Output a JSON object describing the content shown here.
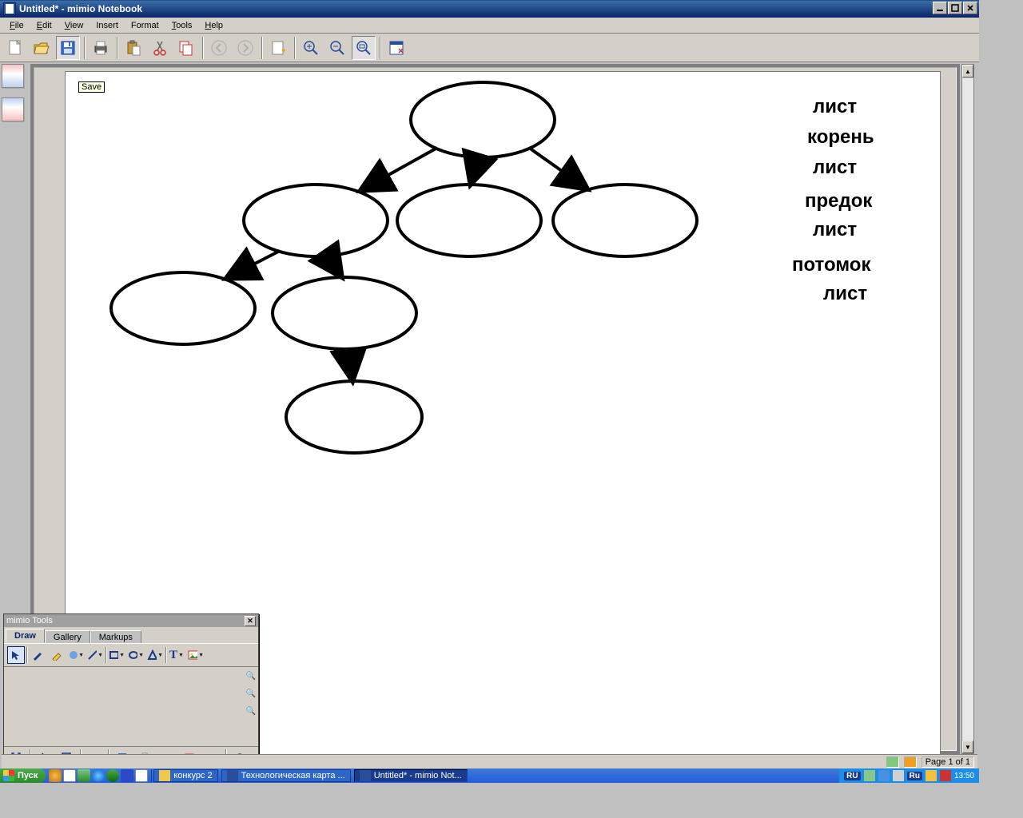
{
  "window": {
    "title": "Untitled* - mimio Notebook"
  },
  "menu": {
    "file": "File",
    "edit": "Edit",
    "view": "View",
    "insert": "Insert",
    "format": "Format",
    "tools": "Tools",
    "help": "Help"
  },
  "tooltip": {
    "save": "Save"
  },
  "canvas_labels": {
    "l1": "лист",
    "l2": "корень",
    "l3": "лист",
    "l4": "предок",
    "l5": "лист",
    "l6": "потомок",
    "l7": "лист"
  },
  "tools_panel": {
    "title": "mimio Tools",
    "tabs": {
      "draw": "Draw",
      "gallery": "Gallery",
      "markups": "Markups"
    }
  },
  "statusbar": {
    "page": "Page 1 of 1"
  },
  "taskbar": {
    "start": "Пуск",
    "items": {
      "t1": "конкурс 2",
      "t2": "Технологическая карта ...",
      "t3": "Untitled* - mimio Not..."
    },
    "lang1": "RU",
    "lang2": "Ru",
    "clock": "13:50"
  }
}
